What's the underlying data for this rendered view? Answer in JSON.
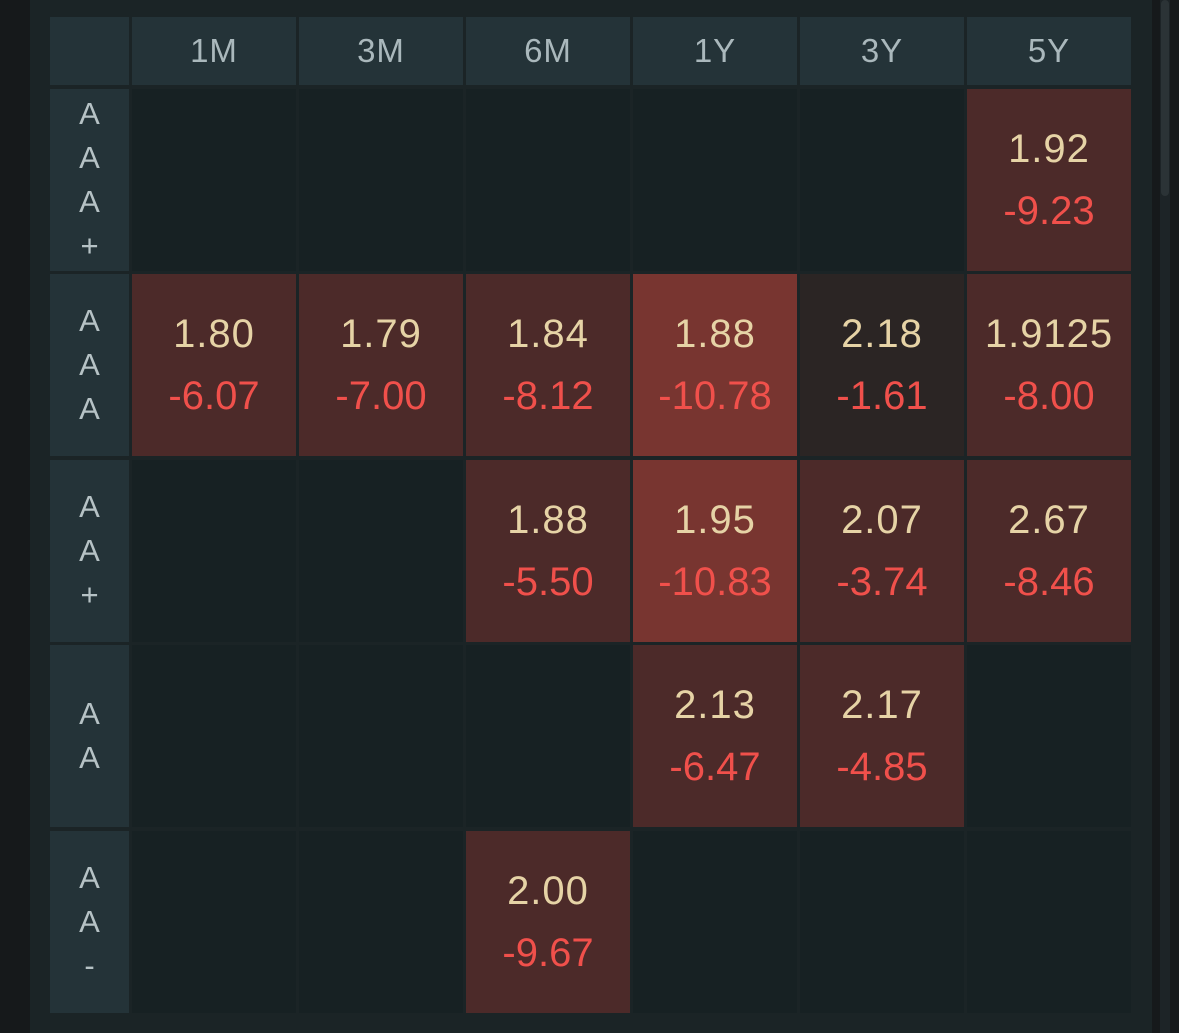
{
  "columns": [
    "1M",
    "3M",
    "6M",
    "1Y",
    "3Y",
    "5Y"
  ],
  "rows": [
    {
      "label": "AAA+",
      "chars": [
        "A",
        "A",
        "A",
        "+"
      ]
    },
    {
      "label": "AAA",
      "chars": [
        "A",
        "A",
        "A"
      ]
    },
    {
      "label": "AA+",
      "chars": [
        "A",
        "A",
        "+"
      ]
    },
    {
      "label": "AA",
      "chars": [
        "A",
        "A"
      ]
    },
    {
      "label": "AA-",
      "chars": [
        "A",
        "A",
        "-"
      ]
    }
  ],
  "cells": {
    "r0": {
      "c5": {
        "rate": "1.92",
        "change": "-9.23"
      }
    },
    "r1": {
      "c0": {
        "rate": "1.80",
        "change": "-6.07"
      },
      "c1": {
        "rate": "1.79",
        "change": "-7.00"
      },
      "c2": {
        "rate": "1.84",
        "change": "-8.12"
      },
      "c3": {
        "rate": "1.88",
        "change": "-10.78"
      },
      "c4": {
        "rate": "2.18",
        "change": "-1.61"
      },
      "c5": {
        "rate": "1.9125",
        "change": "-8.00"
      }
    },
    "r2": {
      "c2": {
        "rate": "1.88",
        "change": "-5.50"
      },
      "c3": {
        "rate": "1.95",
        "change": "-10.83"
      },
      "c4": {
        "rate": "2.07",
        "change": "-3.74"
      },
      "c5": {
        "rate": "2.67",
        "change": "-8.46"
      }
    },
    "r3": {
      "c3": {
        "rate": "2.13",
        "change": "-6.47"
      },
      "c4": {
        "rate": "2.17",
        "change": "-4.85"
      }
    },
    "r4": {
      "c2": {
        "rate": "2.00",
        "change": "-9.67"
      }
    }
  },
  "colors": {
    "background": "#16191b",
    "panel": "#1b2426",
    "header": "#243338",
    "empty_cell": "#172123",
    "cell_moderate": "#4c2a29",
    "cell_strong": "#783530",
    "cell_weak": "#2b2524",
    "rate_text": "#e6d3a6",
    "change_text": "#f0504b"
  }
}
